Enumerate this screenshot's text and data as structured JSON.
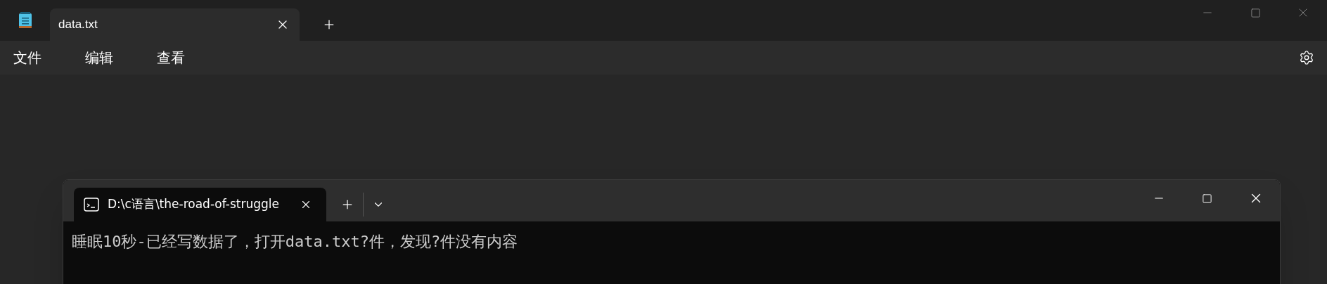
{
  "notepad": {
    "tabs": [
      {
        "label": "data.txt",
        "selected": true
      }
    ],
    "menu": [
      "文件",
      "编辑",
      "查看"
    ]
  },
  "terminal": {
    "tabs": [
      {
        "label": "D:\\c语言\\the-road-of-struggle",
        "selected": true
      }
    ],
    "output": "睡眠10秒-已经写数据了，打开data.txt?件，发现?件没有内容"
  }
}
